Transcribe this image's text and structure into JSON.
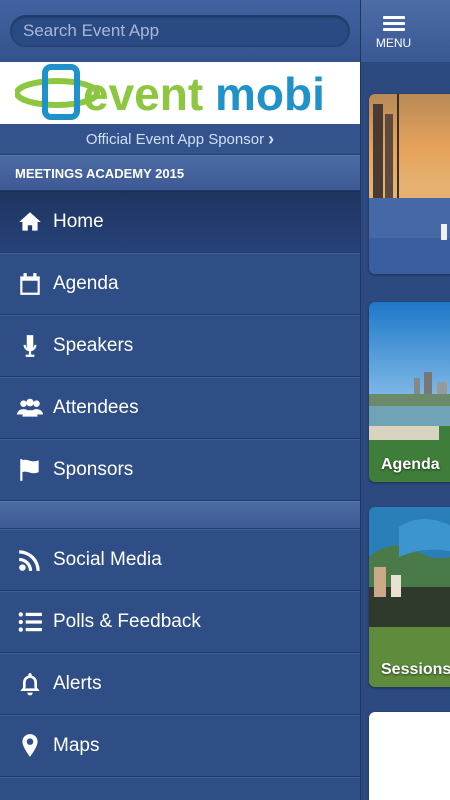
{
  "search": {
    "placeholder": "Search Event App"
  },
  "sponsor": {
    "logo_part1": "event",
    "logo_part2": "mobi",
    "link_label": "Official Event App Sponsor",
    "link_chevron": "›"
  },
  "event": {
    "title": "MEETINGS ACADEMY 2015"
  },
  "nav": {
    "group1": [
      {
        "label": "Home",
        "icon": "home-icon"
      },
      {
        "label": "Agenda",
        "icon": "calendar-icon"
      },
      {
        "label": "Speakers",
        "icon": "microphone-icon"
      },
      {
        "label": "Attendees",
        "icon": "people-icon"
      },
      {
        "label": "Sponsors",
        "icon": "flag-icon"
      }
    ],
    "group2": [
      {
        "label": "Social Media",
        "icon": "rss-icon"
      },
      {
        "label": "Polls & Feedback",
        "icon": "list-icon"
      },
      {
        "label": "Alerts",
        "icon": "bell-icon"
      },
      {
        "label": "Maps",
        "icon": "map-pin-icon"
      }
    ]
  },
  "topbar": {
    "menu_label": "MENU"
  },
  "tiles": [
    {
      "label": ""
    },
    {
      "label": "Agenda"
    },
    {
      "label": "Sessions"
    }
  ],
  "colors": {
    "sidebar_bg": "#2f4e86",
    "brand_green": "#8dc63f",
    "brand_blue": "#1f93c9"
  }
}
